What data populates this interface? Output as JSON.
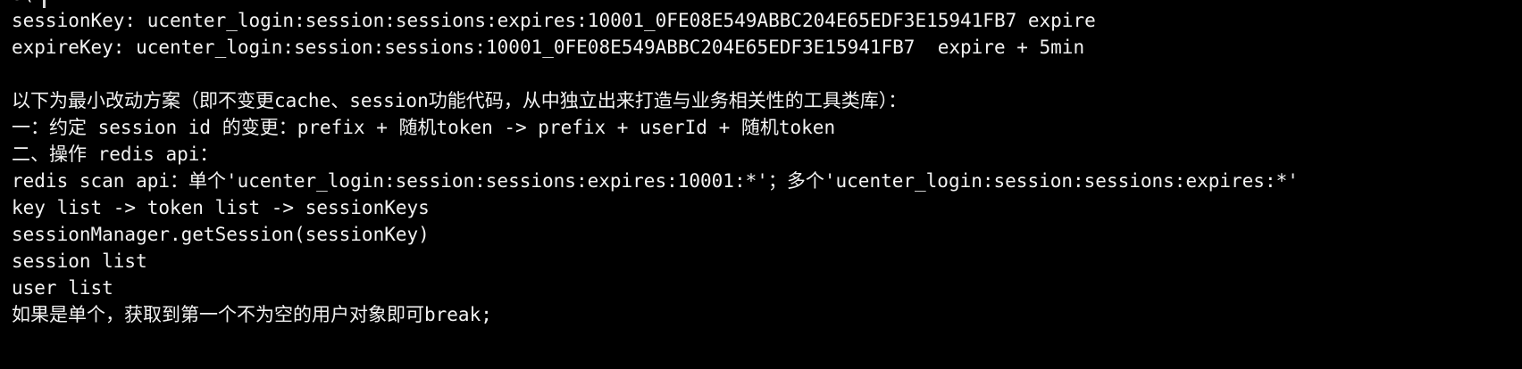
{
  "terminal": {
    "partial_top_text": "S(",
    "lines": [
      "sessionKey: ucenter_login:session:sessions:expires:10001_0FE08E549ABBC204E65EDF3E15941FB7 expire",
      "expireKey: ucenter_login:session:sessions:10001_0FE08E549ABBC204E65EDF3E15941FB7  expire + 5min",
      "",
      "以下为最小改动方案（即不变更cache、session功能代码，从中独立出来打造与业务相关性的工具类库）：",
      "一：约定 session id 的变更：prefix + 随机token -> prefix + userId + 随机token",
      "二、操作 redis api：",
      "redis scan api：单个'ucenter_login:session:sessions:expires:10001:*'；多个'ucenter_login:session:sessions:expires:*'",
      "key list -> token list -> sessionKeys",
      "sessionManager.getSession(sessionKey)",
      "session list",
      "user list",
      "如果是单个，获取到第一个不为空的用户对象即可break;"
    ]
  }
}
